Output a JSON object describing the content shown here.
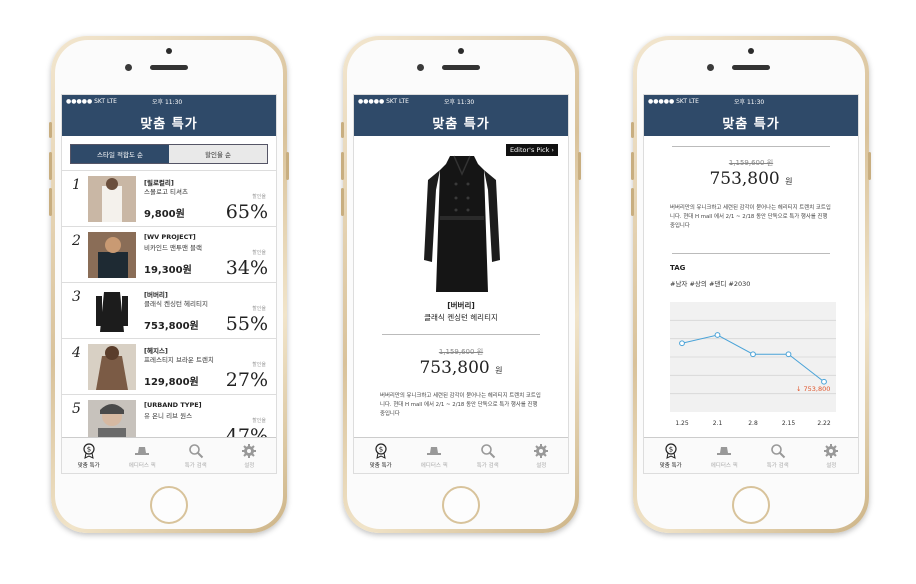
{
  "status": {
    "signal": "●●●●● SKT",
    "network": "LTE",
    "time": "오후 11:30"
  },
  "app_title": "맞춤 특가",
  "tabs": [
    {
      "label": "맞춤 특가",
      "icon": "dollar-medal-icon"
    },
    {
      "label": "에디터스 픽",
      "icon": "hat-icon"
    },
    {
      "label": "특가 검색",
      "icon": "search-icon"
    },
    {
      "label": "설정",
      "icon": "gear-icon"
    }
  ],
  "list_screen": {
    "segments": [
      "스타일 적합도 순",
      "할인율 순"
    ],
    "discount_label": "할인율",
    "items": [
      {
        "rank": "1",
        "brand": "[릴로컬리]",
        "name": "스몰로고 티셔츠",
        "price": "9,800원",
        "discount": "65%",
        "img_color": "#c9b7a5"
      },
      {
        "rank": "2",
        "brand": "[WV PROJECT]",
        "name": "비카인드 맨투맨 블랙",
        "price": "19,300원",
        "discount": "34%",
        "img_color": "#8a6d57"
      },
      {
        "rank": "3",
        "brand": "[버버리]",
        "name": "클래식 켄싱턴 헤리티지",
        "price": "753,800원",
        "discount": "55%",
        "img_color": "#1c1c1c"
      },
      {
        "rank": "4",
        "brand": "[헤지스]",
        "name": "프레스티지 브라운 트렌치",
        "price": "129,800원",
        "discount": "27%",
        "img_color": "#7b5b45"
      },
      {
        "rank": "5",
        "brand": "[URBAND TYPE]",
        "name": "유 온니 리브 원스",
        "price": "",
        "discount": "47%",
        "img_color": "#a69a90"
      }
    ]
  },
  "detail_screen": {
    "badge": "Editor's Pick ›",
    "brand": "[버버리]",
    "name": "클래식 켄싱턴 헤리티지",
    "old_price": "1,159,600 원",
    "new_price": "753,800",
    "unit": "원",
    "description": "버버리만의 유니크하고 세련된 감각이 묻어나는 헤리티지 트렌치 코트입니다. 현대 H mall 에서 2/1 ~ 2/18 동안 단독으로 특가 행사를 진행 중입니다"
  },
  "chart_screen": {
    "old_price": "1,159,600 원",
    "new_price": "753,800",
    "unit": "원",
    "description": "버버리만의 유니크하고 세련된 감각이 묻어나는 헤리티지 트렌치 코트입니다. 현대 H mall 에서 2/1 ~ 2/18 동안 단독으로 특가 행사를 진행 중입니다",
    "tag_title": "TAG",
    "tags": "#남자 #상의 #댄디 #2030",
    "price_annotation": "↓ 753,800"
  },
  "chart_data": {
    "type": "line",
    "x": [
      "1.25",
      "2.1",
      "2.8",
      "2.15",
      "2.22"
    ],
    "series": [
      {
        "values": [
          5,
          5.6,
          4.2,
          4.2,
          2.2
        ]
      }
    ],
    "ylim": [
      0,
      8
    ],
    "grid": true,
    "colors": {
      "line": "#4aa3d8",
      "annotation": "#e0552b"
    }
  }
}
